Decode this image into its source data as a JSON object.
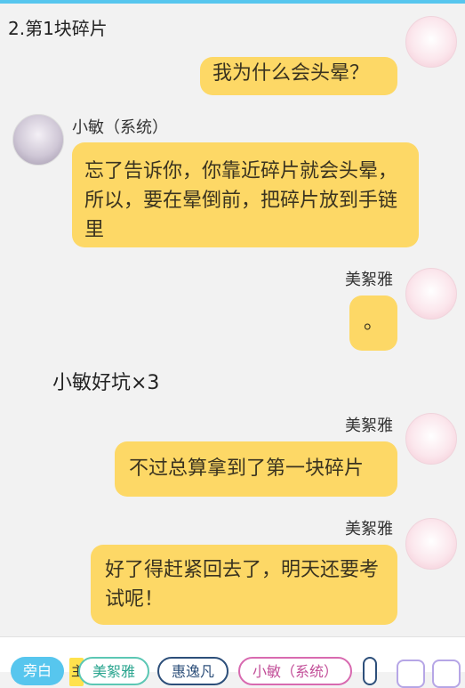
{
  "title": "2.第1块碎片",
  "messages": [
    {
      "text": "我为什么会头晕？"
    },
    {
      "name": "小敏（系统）",
      "text": "忘了告诉你，你靠近碎片就会头晕，所以，要在晕倒前，把碎片放到手链里"
    },
    {
      "name": "美絮雅",
      "text": "。"
    },
    {
      "name": "美絮雅",
      "text": "不过总算拿到了第一块碎片"
    },
    {
      "name": "美絮雅",
      "text": "好了得赶紧回去了，明天还要考试呢！"
    }
  ],
  "narration": "小敏好坑×3",
  "bottom": {
    "chip0": "旁白",
    "chip_small": "主",
    "chips": [
      "美絮雅",
      "惠逸凡",
      "小敏（系统）"
    ]
  },
  "colors": {
    "bubble": "#fdd866",
    "accent": "#57c6ee"
  }
}
